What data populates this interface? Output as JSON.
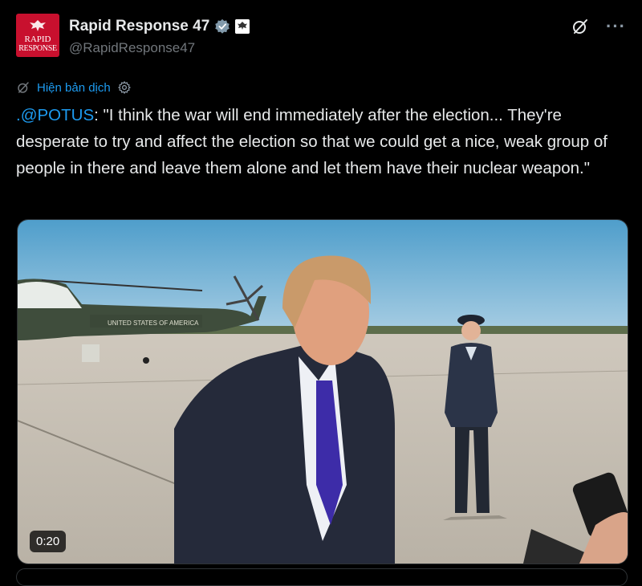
{
  "account": {
    "name": "Rapid Response 47",
    "handle": "@RapidResponse47",
    "avatar_text_line1": "RAPID",
    "avatar_text_line2": "RESPONSE"
  },
  "translate": {
    "label": "Hiện bản dịch"
  },
  "tweet": {
    "mention": ".@POTUS",
    "text": ": \"I think the war will end immediately after the election... They're desperate to try and affect the election so that we could get a nice, weak group of people in there and leave them alone and let them have their nuclear weapon.\""
  },
  "media": {
    "timestamp": "0:20",
    "helicopter_marking": "UNITED STATES OF AMERICA"
  },
  "icons": {
    "verified": "verified-badge-icon",
    "affiliation": "affiliation-badge-icon",
    "grok": "grok-icon",
    "more": "more-icon",
    "translate": "translate-icon",
    "settings": "settings-icon"
  },
  "colors": {
    "background": "#000000",
    "link": "#1d9bf0",
    "text": "#e7e9ea",
    "secondary": "#71767b",
    "avatar_bg": "#c8102e"
  }
}
